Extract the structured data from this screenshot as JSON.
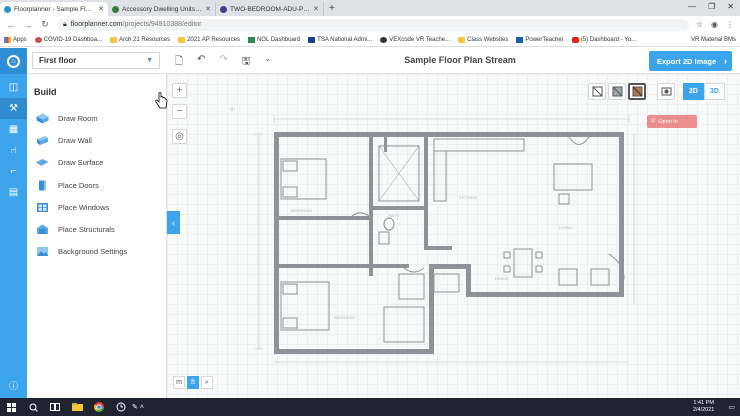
{
  "browser": {
    "tabs": [
      {
        "title": "Floorplanner - Sample Floor Pla",
        "color": "#2e8fd6",
        "active": true
      },
      {
        "title": "Accessory Dwelling Units (ADU...",
        "color": "#3a7d44",
        "active": false
      },
      {
        "title": "TWO-BEDROOM-ADU-PLAN",
        "color": "#4b3a8c",
        "active": false
      }
    ],
    "new_tab": "+",
    "address": {
      "host": "floorplanner.com",
      "path": "/projects/94910388/editor"
    },
    "bookmarks": [
      {
        "label": "Apps",
        "type": "apps"
      },
      {
        "label": "COVID-19 Dashboa...",
        "type": "page"
      },
      {
        "label": "Arch 21 Resources",
        "type": "folder"
      },
      {
        "label": "2021 AP Resources",
        "type": "folder"
      },
      {
        "label": "NGL Dashboard",
        "type": "page"
      },
      {
        "label": "TSA National Admi...",
        "type": "page"
      },
      {
        "label": "VEXcode VR Teache...",
        "type": "page"
      },
      {
        "label": "Class Websites",
        "type": "folder"
      },
      {
        "label": "PowerTeacher",
        "type": "page"
      },
      {
        "label": "(5) Dashboard - Yo...",
        "type": "page"
      }
    ],
    "bookmarks_right": "VR Material BMs"
  },
  "header": {
    "floor_select": "First floor",
    "project_title": "Sample Floor Plan Stream",
    "export_label": "Export 2D Image"
  },
  "build_panel": {
    "title": "Build",
    "tools": [
      {
        "label": "Draw Room",
        "icon": "draw-room-icon"
      },
      {
        "label": "Draw Wall",
        "icon": "draw-wall-icon"
      },
      {
        "label": "Draw Surface",
        "icon": "draw-surface-icon"
      },
      {
        "label": "Place Doors",
        "icon": "door-icon"
      },
      {
        "label": "Place Windows",
        "icon": "window-icon"
      },
      {
        "label": "Place Structurals",
        "icon": "structural-icon"
      },
      {
        "label": "Background Settings",
        "icon": "background-icon"
      }
    ]
  },
  "canvas": {
    "zoom_in": "+",
    "zoom_out": "−",
    "mode_2d": "2D",
    "mode_3d": "3D",
    "open_chip": "Open in",
    "units": {
      "m": "m",
      "ft": "ft"
    },
    "plan_labels": {
      "bedroom": "BEDROOM",
      "bath": "BATH",
      "kitchen": "KITCHEN",
      "living": "LIVING",
      "dining": "DINING"
    }
  },
  "taskbar": {
    "time": "1:41 PM",
    "date": "2/4/2021"
  },
  "colors": {
    "accent": "#3ba4ea",
    "accent_dark": "#2e8fd6",
    "wall": "#8f9296"
  }
}
